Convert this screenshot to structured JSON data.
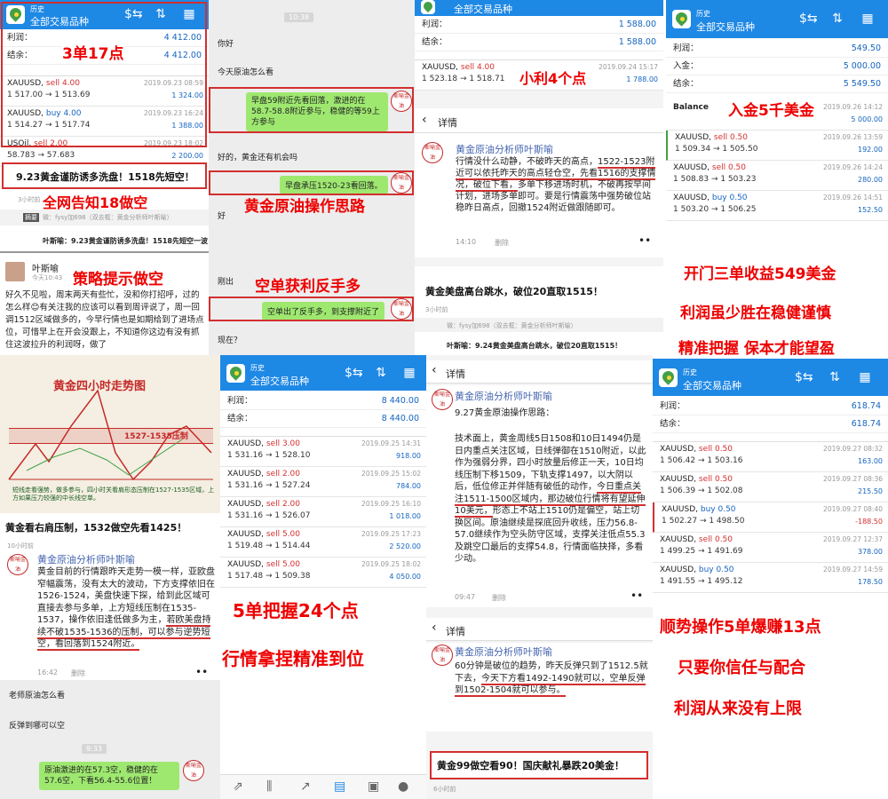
{
  "app": {
    "history": "历史",
    "all_symbols": "全部交易品种",
    "details": "详情"
  },
  "labels": {
    "profit": "利润：",
    "balance": "结余：",
    "deposit": "入金：",
    "balance_en": "Balance",
    "delete": "删除"
  },
  "author": "黄金原油分析师叶斯喻",
  "author_short": "叶斯喻",
  "seal": "斯喻金油",
  "p1": {
    "profit": "4 412.00",
    "balance": "4 412.00",
    "trades": [
      {
        "sym": "XAUUSD, ",
        "dir": "sell 4.00",
        "dt": "2019.09.23 08:59",
        "px": "1 517.00 → 1 513.69",
        "pf": "1 324.00"
      },
      {
        "sym": "XAUUSD, ",
        "dir": "buy 4.00",
        "dt": "2019.09.23 16:24",
        "px": "1 514.27 → 1 517.74",
        "pf": "1 388.00"
      },
      {
        "sym": "USOil, ",
        "dir": "sell 2.00",
        "dt": "2019.09.23 18:02",
        "px": "58.783 → 57.683",
        "pf": "2 200.00"
      }
    ],
    "cap": "3单17点",
    "headline": "9.23黄金谨防诱多洗盘！1518先短空！",
    "cap2": "全网告知18做空",
    "src": "3小时前",
    "tag": "摘要",
    "wx": "微：fysy加698（双去框：黄金分析师叶斯喻）",
    "name_line": "叶斯喻：9.23黄金谨防诱多洗盘！1518先短空一波！",
    "cap3": "策略提示做空",
    "today": "今天10:43",
    "post": "好久不见啦，周末两天有些忙，没和你打招呼，过的怎么样😊有关注我的应该可以看到周评说了，周一回调1512区域做多的，今早行情也是如期给到了进场点位，可惜早上在开会没跟上，不知道你这边有没有抓住这波拉升的利润呀，做了"
  },
  "p2": {
    "time1": "10:38",
    "m1": "你好",
    "m2": "今天原油怎么看",
    "r1": "早盘59附近先看回落，激进的在58.7-58.8附近参与，稳健的等59上方参与",
    "m3": "好的，黄金还有机会吗",
    "r2": "早盘承压1520-23看回落。",
    "cap1": "黄金原油操作思路",
    "m4": "好",
    "m5": "刚出",
    "cap2": "空单获利反手多",
    "r3": "空单出了反手多，到支撑附近了",
    "m6": "现在？"
  },
  "p3": {
    "profit": "1 588.00",
    "balance": "1 588.00",
    "trade": {
      "sym": "XAUUSD, ",
      "dir": "sell 4.00",
      "dt": "2019.09.24 15:17",
      "px": "1 523.18 → 1 518.71",
      "pf": "1 788.00"
    },
    "cap": "小利4个点",
    "post": "行情没什么动静，不破昨天的高点，",
    "post_u": "1522-1523附近可以依托昨天的高点轻仓空，先看1516的支撑情况，破位下看，",
    "post2": "多单下移进场时机，不破再按早间计划，进场多单即可。要是行情震荡中强势破位站稳昨日高点，回撤1524附近做跟随即可。",
    "time": "14:10",
    "title": "黄金美盘高台跳水，破位20直取1515！",
    "ago": "3小时前",
    "wx": "微：fysy加698（双去框：黄金分析师叶斯喻）",
    "name_line": "叶斯喻：9.24黄金美盘高台跳水，破位20直取1515！"
  },
  "p4": {
    "profit": "549.50",
    "deposit": "5 000.00",
    "balance": "5 549.50",
    "bal_dt": "2019.09.26 14:12",
    "bal_v": "5 000.00",
    "cap": "入金5千美金",
    "trades": [
      {
        "sym": "XAUUSD, ",
        "dir": "sell 0.50",
        "dt": "2019.09.26 13:59",
        "px": "1 509.34 → 1 505.50",
        "pf": "192.00"
      },
      {
        "sym": "XAUUSD, ",
        "dir": "sell 0.50",
        "dt": "2019.09.26 14:24",
        "px": "1 508.83 → 1 503.23",
        "pf": "280.00"
      },
      {
        "sym": "XAUUSD, ",
        "dir": "buy 0.50",
        "dt": "2019.09.26 14:51",
        "px": "1 503.20 → 1 506.25",
        "pf": "152.50"
      }
    ],
    "s1": "开门三单收益549美金",
    "s2": "利润虽少胜在稳健谨慎",
    "s3": "精准把握 保本才能望盈"
  },
  "p5": {
    "chart_title": "黄金四小时走势图",
    "zone": "1527-1535压制",
    "note": "短线走看强势，做多参与，四小时关看肩形态压制在1527-1535区域，上方如果压力较强的中长线空单。",
    "title": "黄金看右肩压制，1532做空先看1425！",
    "ago": "10小时前",
    "post": "黄金目前的行情跟昨天走势一模一样，亚欧盘窄幅震荡，没有太大的波动，下方支撑依旧在1526-1524，美盘快速下探，给到此区域可直接去参与多单，上方短线压制在1535-1537，操作依旧逢低做多为主，",
    "post_u": "若欧美盘持续不破1535-1536的压制，可以参与逆势短空，看回落到1524附近。",
    "time": "16:42",
    "m1": "老师原油怎么看",
    "m2": "反弹到哪可以空",
    "time2": "9:33",
    "r1": "原油激进的在57.3空，稳健的在57.6空，下看56.4-55.6位置！"
  },
  "p6": {
    "profit": "8 440.00",
    "balance": "8 440.00",
    "trades": [
      {
        "sym": "XAUUSD, ",
        "dir": "sell 3.00",
        "dt": "2019.09.25 14:31",
        "px": "1 531.16 → 1 528.10",
        "pf": "918.00"
      },
      {
        "sym": "XAUUSD, ",
        "dir": "sell 2.00",
        "dt": "2019.09.25 15:02",
        "px": "1 531.16 → 1 527.24",
        "pf": "784.00"
      },
      {
        "sym": "XAUUSD, ",
        "dir": "sell 2.00",
        "dt": "2019.09.25 16:10",
        "px": "1 531.16 → 1 526.07",
        "pf": "1 018.00"
      },
      {
        "sym": "XAUUSD, ",
        "dir": "sell 5.00",
        "dt": "2019.09.25 17:23",
        "px": "1 519.48 → 1 514.44",
        "pf": "2 520.00"
      },
      {
        "sym": "XAUUSD, ",
        "dir": "sell 5.00",
        "dt": "2019.09.25 18:02",
        "px": "1 517.48 → 1 509.38",
        "pf": "4 050.00"
      }
    ],
    "s1": "5单把握24个点",
    "s2": "行情拿捏精准到位"
  },
  "p7": {
    "title": "9.27黄金原油操作思路：",
    "post": "技术面上，黄金周线5日1508和10日1494仍是日内重点关注区域，日线弹御在1510附近，以此作为强弱分界，四小时放量后修正一天，10日均线压制下移1509，下轨支撑1497，以大阴以后，低位修正并伴随有破低的动作，",
    "post_u": "今日重点关注1511-1500区域内，那边破位行情将有望延伸10美元，",
    "post2": "形态上不站上1510仍是偏空，站上切换区间。原油继续是探底回升收线，压力56.8-57.0继续作为空头防守区域，支撑关注低点55.3及跳空口最后的支撑54.8，行情面临抉择，多看少动。",
    "time": "09:47",
    "post3": "60分钟是破位的趋势，昨天反弹只到了1512.5就下去，",
    "post3_u": "今天下方看1492-1490就可以，空单反弹到1502-1504就可以参与。",
    "title2": "黄金99做空看90！国庆献礼暴跌20美金！",
    "ago": "6小时前"
  },
  "p8": {
    "profit": "618.74",
    "balance": "618.74",
    "trades": [
      {
        "sym": "XAUUSD, ",
        "dir": "sell 0.50",
        "dt": "2019.09.27 08:32",
        "px": "1 506.42 → 1 503.16",
        "pf": "163.00"
      },
      {
        "sym": "XAUUSD, ",
        "dir": "sell 0.50",
        "dt": "2019.09.27 08:36",
        "px": "1 506.39 → 1 502.08",
        "pf": "215.50"
      },
      {
        "sym": "XAUUSD, ",
        "dir": "buy 0.50",
        "dt": "2019.09.27 08:40",
        "px": "1 502.27 → 1 498.50",
        "pf": "-188.50"
      },
      {
        "sym": "XAUUSD, ",
        "dir": "sell 0.50",
        "dt": "2019.09.27 12:37",
        "px": "1 499.25 → 1 491.69",
        "pf": "378.00"
      },
      {
        "sym": "XAUUSD, ",
        "dir": "buy 0.50",
        "dt": "2019.09.27 14:59",
        "px": "1 491.55 → 1 495.12",
        "pf": "178.50"
      }
    ],
    "s1": "顺势操作5单爆赚13点",
    "s2": "只要你信任与配合",
    "s3": "利润从来没有上限"
  }
}
